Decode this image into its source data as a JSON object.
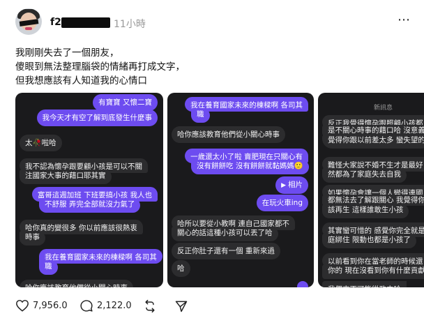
{
  "post": {
    "username_prefix": "f2",
    "time": "11小時",
    "more_icon": "⋯",
    "lines": [
      "我剛剛失去了一個朋友，",
      "傻眼到無法整理腦袋的情緒再打成文字，",
      "但我想應該有人知道我的心情口"
    ]
  },
  "screenshots": {
    "card1": [
      {
        "text": "有寶寶 又懷二寶",
        "side": "out"
      },
      {
        "text": "我今天才有空了解到底發生什麼事",
        "side": "out"
      },
      {
        "text": "太🥀啦哈",
        "side": "in"
      },
      {
        "text": "我不認為懷孕跟要顧小孩是可以不關",
        "side": "in"
      },
      {
        "text": "注國家大事的藉口耶其實",
        "side": "in"
      },
      {
        "text": "富哥這週加班 下班要搞小孩 我人也",
        "side": "out"
      },
      {
        "text": "不舒服 弄完全部就沒力氣了",
        "side": "out"
      },
      {
        "text": "哈你真的變很多 你以前應該很熱衷",
        "side": "in"
      },
      {
        "text": "時事",
        "side": "in"
      },
      {
        "text": "我在養育國家未來的棟樑啊 各司其",
        "side": "out"
      },
      {
        "text": "職",
        "side": "out"
      },
      {
        "text": "哈你應該教育他們從小關心時事",
        "side": "in"
      }
    ],
    "card2": [
      {
        "text": "我在養育國家未來的棟樑啊 各司其",
        "side": "out"
      },
      {
        "text": "職",
        "side": "out"
      },
      {
        "text": "哈你應該教育他們從小關心時事",
        "side": "in"
      },
      {
        "text": "一歲還太小了啦 賣肥現在只關心有",
        "side": "out"
      },
      {
        "text": "沒有餅餅吃 沒有餅餅就黏媽媽🙂",
        "side": "out"
      },
      {
        "text": "相片",
        "side": "out"
      },
      {
        "text": "在玩火車ing",
        "side": "out"
      },
      {
        "text": "哈所以要從小教啊 連自己國家都不",
        "side": "in"
      },
      {
        "text": "關心的話這種小孩可以丟了哈",
        "side": "in"
      },
      {
        "text": "反正你肚子還有一個 重新來過",
        "side": "in"
      },
      {
        "text": "哈",
        "side": "in"
      }
    ],
    "card3": [
      {
        "text": "新訊息",
        "side": "sep"
      },
      {
        "text": "反正我覺得懷孕跟照顧小孩都",
        "side": "in"
      },
      {
        "text": "是不關心時事的藉口哈 沒意義",
        "side": "in"
      },
      {
        "text": "覺得你跟以前差太多 蠻失望的",
        "side": "in"
      },
      {
        "text": "難怪大家說不婚不生才是最好",
        "side": "in"
      },
      {
        "text": "然都為了家庭失去自我",
        "side": "in"
      },
      {
        "text": "如果懷孕會讓一個人變得連國",
        "side": "in"
      },
      {
        "text": "都無法去了解跟關心 我覺得你",
        "side": "in"
      },
      {
        "text": "該再生 這樣誰敢生小孩",
        "side": "in"
      },
      {
        "text": "其實蠻可惜的 感覺你完全就是",
        "side": "in"
      },
      {
        "text": "庭綁住 限動也都是小孩了",
        "side": "in"
      },
      {
        "text": "以前看到你在當老師的時候還",
        "side": "in"
      },
      {
        "text": "你的 現在沒看到你有什麼貢獻",
        "side": "in"
      },
      {
        "text": "我們來不可能從政中哈",
        "side": "in"
      }
    ]
  },
  "actions": {
    "likes": "7,956.0",
    "comments": "2,122.0",
    "repost_icon": "repost-icon",
    "share_icon": "send-icon"
  }
}
